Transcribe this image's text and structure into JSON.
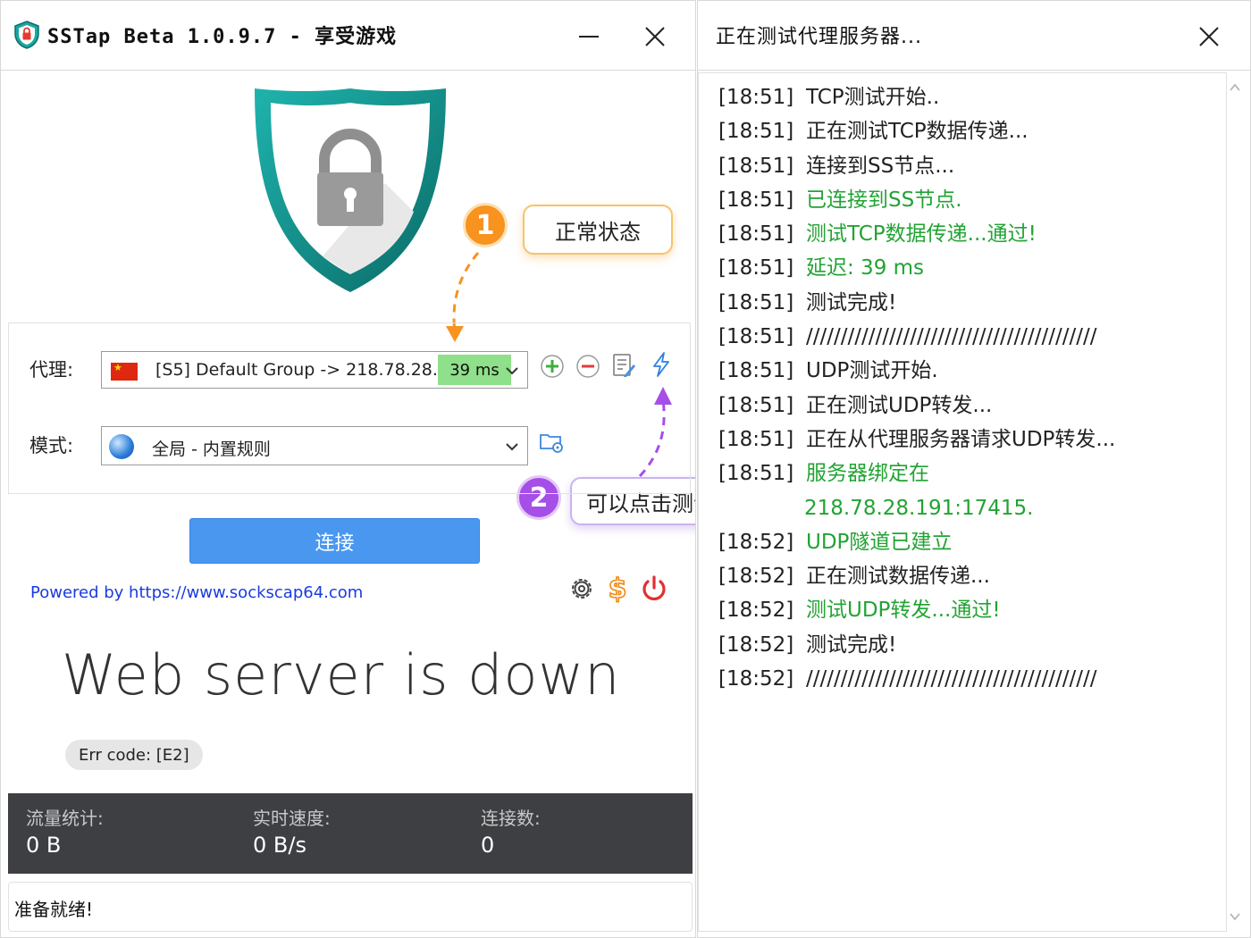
{
  "main_window": {
    "title": "SSTap Beta 1.0.9.7 - 享受游戏",
    "proxy_label": "代理:",
    "proxy_value": "[S5] Default Group -> 218.78.28....",
    "proxy_latency": "39 ms",
    "mode_label": "模式:",
    "mode_value": "全局 - 内置规则",
    "connect_label": "连接",
    "powered_by": "Powered by https://www.sockscap64.com",
    "server_message": "Web server is down",
    "error_code": "Err code: [E2]",
    "stats": [
      {
        "label": "流量统计:",
        "value": "0 B"
      },
      {
        "label": "实时速度:",
        "value": "0 B/s"
      },
      {
        "label": "连接数:",
        "value": "0"
      }
    ],
    "status": "准备就绪!"
  },
  "annotations": {
    "badge_1": "1",
    "callout_1": "正常状态",
    "badge_2": "2",
    "callout_2": "可以点击测试"
  },
  "test_window": {
    "title": "正在测试代理服务器...",
    "log": [
      {
        "time": "[18:51]",
        "message": "TCP测试开始..",
        "ok": false
      },
      {
        "time": "[18:51]",
        "message": "正在测试TCP数据传递...",
        "ok": false
      },
      {
        "time": "[18:51]",
        "message": "连接到SS节点...",
        "ok": false
      },
      {
        "time": "[18:51]",
        "message": "已连接到SS节点.",
        "ok": true
      },
      {
        "time": "[18:51]",
        "message": "测试TCP数据传递...通过!",
        "ok": true
      },
      {
        "time": "[18:51]",
        "message": "延迟:  39 ms",
        "ok": true
      },
      {
        "time": "[18:51]",
        "message": "测试完成!",
        "ok": false
      },
      {
        "time": "[18:51]",
        "message": "//////////////////////////////////////////",
        "ok": false
      },
      {
        "time": "[18:51]",
        "message": "UDP测试开始.",
        "ok": false
      },
      {
        "time": "[18:51]",
        "message": "正在测试UDP转发...",
        "ok": false
      },
      {
        "time": "[18:51]",
        "message": "正在从代理服务器请求UDP转发...",
        "ok": false
      },
      {
        "time": "[18:51]",
        "message": "服务器绑定在",
        "ok": true
      },
      {
        "time": "",
        "message": "218.78.28.191:17415.",
        "ok": true
      },
      {
        "time": "[18:52]",
        "message": "UDP隧道已建立",
        "ok": true
      },
      {
        "time": "[18:52]",
        "message": "正在测试数据传递...",
        "ok": false
      },
      {
        "time": "[18:52]",
        "message": "测试UDP转发...通过!",
        "ok": true
      },
      {
        "time": "[18:52]",
        "message": "测试完成!",
        "ok": false
      },
      {
        "time": "[18:52]",
        "message": "//////////////////////////////////////////",
        "ok": false
      }
    ]
  },
  "colors": {
    "connect_button": "#4a97f0",
    "log_success": "#22a333",
    "latency_badge": "#8fe08a",
    "stats_bar": "#3d3f43",
    "badge_1": "#f7931e",
    "badge_2": "#a64ee8"
  },
  "icons": [
    "shield-lock-icon",
    "minimize-icon",
    "close-icon",
    "china-flag-icon",
    "chevron-down-icon",
    "add-icon",
    "remove-icon",
    "edit-icon",
    "lightning-icon",
    "globe-icon",
    "folder-settings-icon",
    "gear-icon",
    "dollar-icon",
    "power-icon"
  ]
}
